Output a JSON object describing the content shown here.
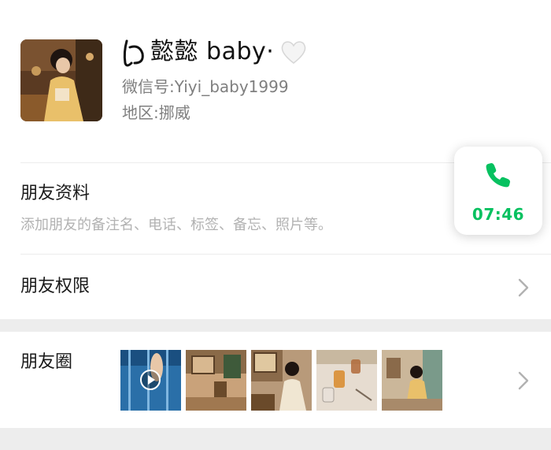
{
  "profile": {
    "name": "懿懿 baby·",
    "wechat_id_label": "微信号:",
    "wechat_id": "Yiyi_baby1999",
    "region_label": "地区:",
    "region": "挪威"
  },
  "friend_info": {
    "title": "朋友资料",
    "subtitle": "添加朋友的备注名、电话、标签、备忘、照片等。"
  },
  "permissions": {
    "title": "朋友权限"
  },
  "moments": {
    "title": "朋友圈",
    "thumbnail_count": 5
  },
  "call": {
    "time": "07:46",
    "accent": "#07c160"
  },
  "colors": {
    "background": "#ffffff",
    "separator": "#ededed",
    "secondary_text": "#7f7f7f",
    "hint_text": "#b2b2b2"
  }
}
